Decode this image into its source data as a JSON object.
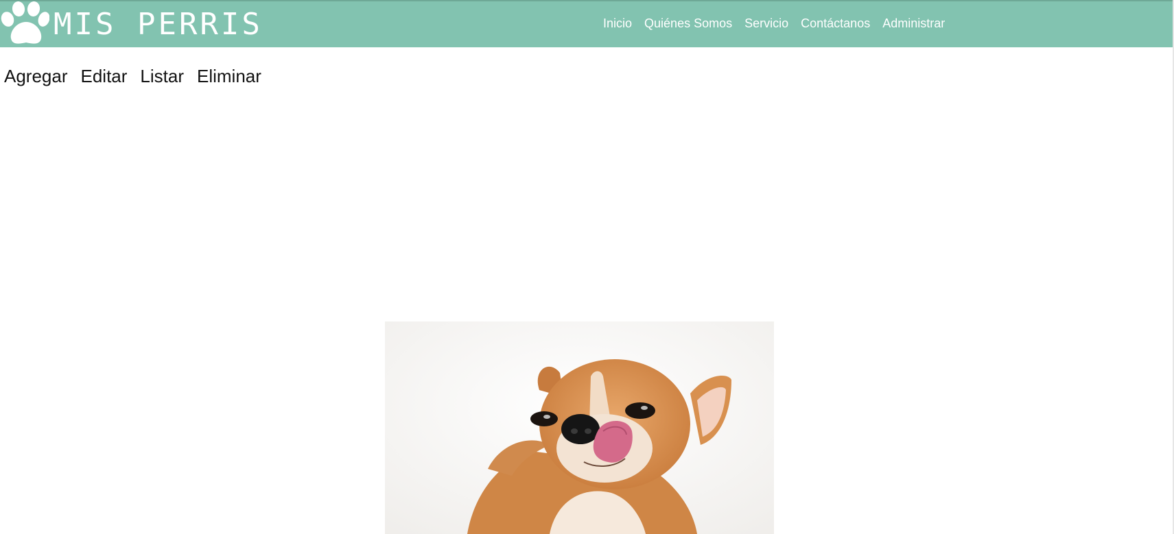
{
  "brand": {
    "name": "MIS PERRIS",
    "logo_icon": "paw-icon"
  },
  "nav": {
    "items": [
      {
        "label": "Inicio"
      },
      {
        "label": "Quiénes Somos"
      },
      {
        "label": "Servicio"
      },
      {
        "label": "Contáctanos"
      },
      {
        "label": "Administrar"
      }
    ]
  },
  "admin_menu": {
    "items": [
      {
        "label": "Agregar"
      },
      {
        "label": "Editar"
      },
      {
        "label": "Listar"
      },
      {
        "label": "Eliminar"
      }
    ]
  },
  "hero_image": {
    "subject": "chihuahua-photo"
  },
  "colors": {
    "navbar": "#82c3b0",
    "nav_text": "#ffffff",
    "menu_text": "#111111",
    "page_bg": "#ffffff"
  }
}
